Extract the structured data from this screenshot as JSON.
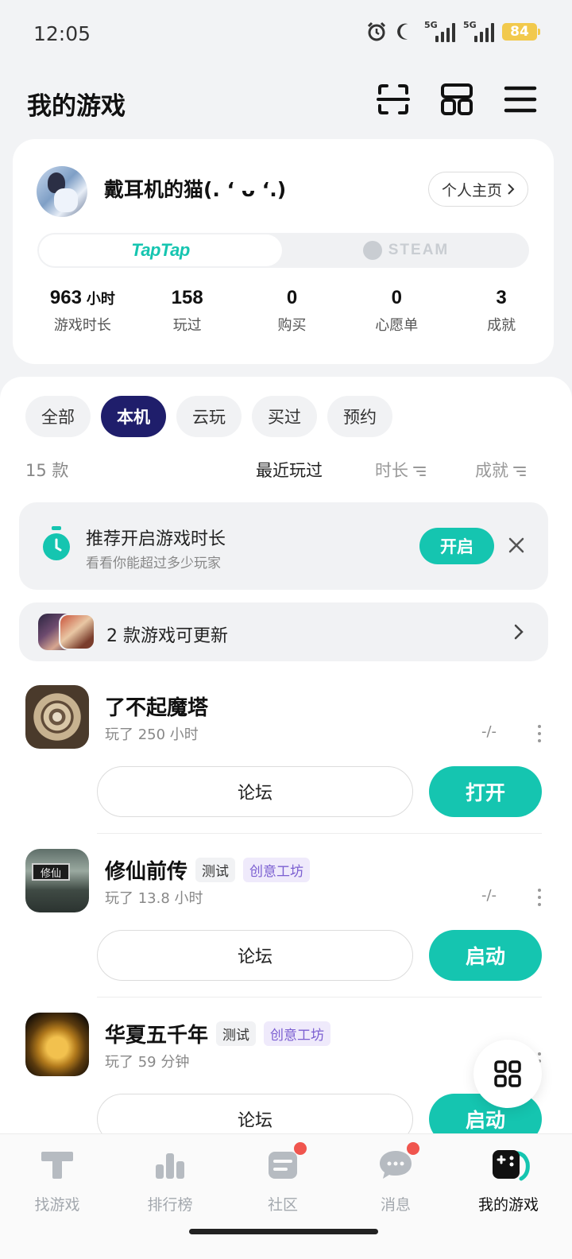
{
  "status_bar": {
    "time": "12:05",
    "network1": "5G",
    "network2": "5G",
    "battery": "84"
  },
  "header": {
    "title": "我的游戏"
  },
  "profile": {
    "username": "戴耳机的猫(. ‘ ᴗ ‘.)",
    "homepage_label": "个人主页",
    "platforms": [
      "TapTap",
      "STEAM"
    ],
    "stats": [
      {
        "value": "963",
        "unit": "小时",
        "label": "游戏时长"
      },
      {
        "value": "158",
        "unit": "",
        "label": "玩过"
      },
      {
        "value": "0",
        "unit": "",
        "label": "购买"
      },
      {
        "value": "0",
        "unit": "",
        "label": "心愿单"
      },
      {
        "value": "3",
        "unit": "",
        "label": "成就"
      }
    ]
  },
  "filters": [
    "全部",
    "本机",
    "云玩",
    "买过",
    "预约"
  ],
  "active_filter": "本机",
  "sort": {
    "count": "15 款",
    "options": [
      "最近玩过",
      "时长",
      "成就"
    ]
  },
  "banner": {
    "title": "推荐开启游戏时长",
    "subtitle": "看看你能超过多少玩家",
    "button": "开启"
  },
  "update": {
    "text": "2 款游戏可更新"
  },
  "games": [
    {
      "name": "了不起魔塔",
      "badges": [],
      "played": "玩了 250 小时",
      "score": "-/-",
      "forum": "论坛",
      "action": "打开"
    },
    {
      "name": "修仙前传",
      "badges": [
        "测试",
        "创意工坊"
      ],
      "played": "玩了 13.8 小时",
      "score": "-/-",
      "forum": "论坛",
      "action": "启动",
      "icon_text": "修仙"
    },
    {
      "name": "华夏五千年",
      "badges": [
        "测试",
        "创意工坊"
      ],
      "played": "玩了 59 分钟",
      "score": "",
      "forum": "论坛",
      "action": "启动"
    }
  ],
  "bottom_nav": [
    {
      "label": "找游戏",
      "icon": "find-game-icon",
      "dot": false
    },
    {
      "label": "排行榜",
      "icon": "ranking-icon",
      "dot": false
    },
    {
      "label": "社区",
      "icon": "community-icon",
      "dot": true
    },
    {
      "label": "消息",
      "icon": "message-icon",
      "dot": true
    },
    {
      "label": "我的游戏",
      "icon": "my-games-icon",
      "dot": false
    }
  ],
  "colors": {
    "accent": "#15c5b0",
    "active_chip": "#1f1e6b",
    "badge_mod": "#7b5fd1",
    "red_dot": "#f0554e"
  }
}
